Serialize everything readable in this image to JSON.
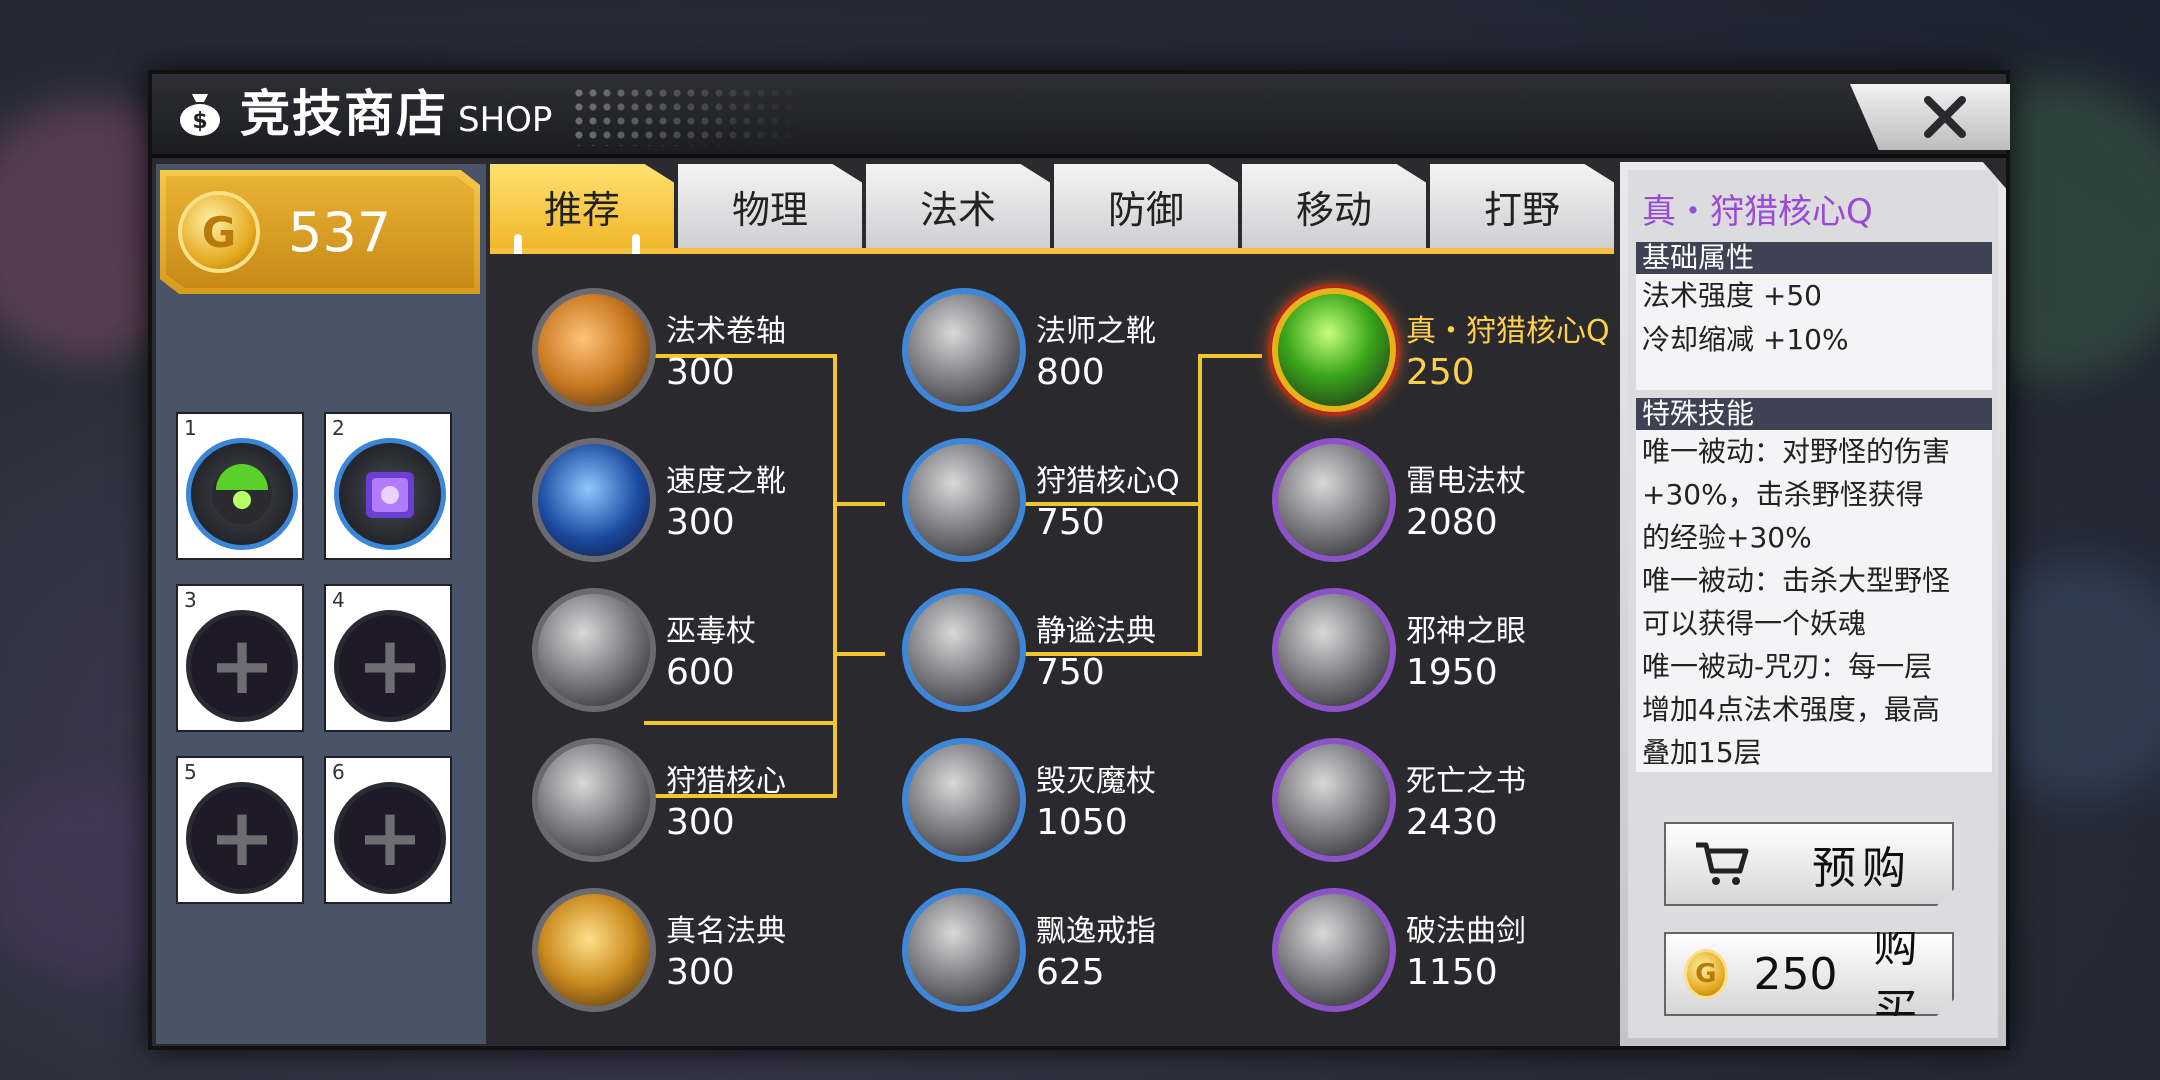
{
  "header": {
    "title": "竞技商店",
    "subtitle": "SHOP"
  },
  "wallet": {
    "gold": "537",
    "coin_glyph": "G"
  },
  "slots": [
    {
      "num": "1",
      "filled": true
    },
    {
      "num": "2",
      "filled": true
    },
    {
      "num": "3",
      "filled": false
    },
    {
      "num": "4",
      "filled": false
    },
    {
      "num": "5",
      "filled": false
    },
    {
      "num": "6",
      "filled": false
    }
  ],
  "tabs": [
    {
      "label": "推荐",
      "active": true
    },
    {
      "label": "物理"
    },
    {
      "label": "法术"
    },
    {
      "label": "防御"
    },
    {
      "label": "移动"
    },
    {
      "label": "打野"
    }
  ],
  "items": {
    "col1": [
      {
        "name": "法术卷轴",
        "price": "300"
      },
      {
        "name": "速度之靴",
        "price": "300"
      },
      {
        "name": "巫毒杖",
        "price": "600"
      },
      {
        "name": "狩猎核心",
        "price": "300"
      },
      {
        "name": "真名法典",
        "price": "300"
      }
    ],
    "col2": [
      {
        "name": "法师之靴",
        "price": "800"
      },
      {
        "name": "狩猎核心Q",
        "price": "750"
      },
      {
        "name": "静谧法典",
        "price": "750"
      },
      {
        "name": "毁灭魔杖",
        "price": "1050"
      },
      {
        "name": "飘逸戒指",
        "price": "625"
      }
    ],
    "col3": [
      {
        "name": "真・狩猎核心Q",
        "price": "250",
        "selected": true
      },
      {
        "name": "雷电法杖",
        "price": "2080"
      },
      {
        "name": "邪神之眼",
        "price": "1950"
      },
      {
        "name": "死亡之书",
        "price": "2430"
      },
      {
        "name": "破法曲剑",
        "price": "1150"
      }
    ]
  },
  "detail": {
    "title": "真・狩猎核心Q",
    "base_header": "基础属性",
    "base_stats": [
      "法术强度 +50",
      "冷却缩减 +10%"
    ],
    "skill_header": "特殊技能",
    "skill_text": "唯一被动：对野怪的伤害\n+30%，击杀野怪获得\n的经验+30%\n唯一被动：击杀大型野怪\n可以获得一个妖魂\n唯一被动-咒刃：每一层\n增加4点法术强度，最高\n叠加15层",
    "prebuy_label": "预购",
    "buy_price": "250",
    "buy_label": "购买"
  },
  "colors": {
    "accent_gold": "#f1b72a",
    "selected_text": "#ffcf4a",
    "title_purple": "#9a4ad4",
    "tier_blue": "#3f86d8",
    "tier_purple": "#8e52c8"
  },
  "icons": {
    "bag": "money-bag-icon",
    "close": "close-icon",
    "cart": "cart-icon",
    "coin": "gold-coin-icon",
    "plus": "plus-icon"
  }
}
